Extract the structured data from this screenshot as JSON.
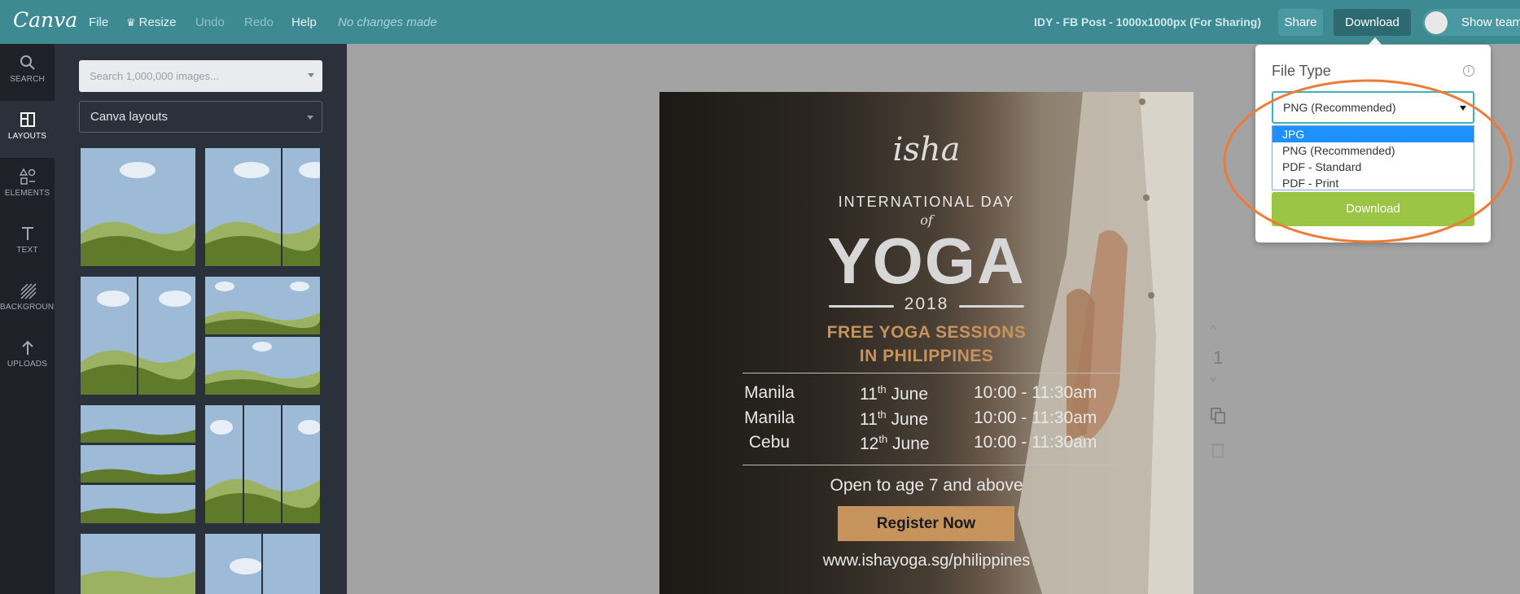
{
  "topbar": {
    "logo": "Canva",
    "menu": {
      "file": "File",
      "resize": "Resize",
      "undo": "Undo",
      "redo": "Redo",
      "help": "Help",
      "status": "No changes made"
    },
    "doc_title": "IDY - FB Post - 1000x1000px (For Sharing)",
    "share": "Share",
    "download": "Download",
    "show_team": "Show team"
  },
  "rail": {
    "items": [
      {
        "label": "SEARCH",
        "icon": "search-icon"
      },
      {
        "label": "LAYOUTS",
        "icon": "layouts-icon"
      },
      {
        "label": "ELEMENTS",
        "icon": "elements-icon"
      },
      {
        "label": "TEXT",
        "icon": "text-icon"
      },
      {
        "label": "BACKGROUND",
        "icon": "background-icon"
      },
      {
        "label": "UPLOADS",
        "icon": "uploads-icon"
      }
    ]
  },
  "panel": {
    "search_placeholder": "Search 1,000,000 images...",
    "layout_select": "Canva layouts"
  },
  "design": {
    "logo": "isha",
    "intl": "INTERNATIONAL DAY",
    "of": "of",
    "yoga": "YOGA",
    "year": "2018",
    "free1": "FREE YOGA SESSIONS",
    "free2": "IN PHILIPPINES",
    "schedule": [
      {
        "city": "Manila",
        "day": "11",
        "sup": "th",
        "month": "June",
        "time": "10:00 - 11:30am"
      },
      {
        "city": "Manila",
        "day": "11",
        "sup": "th",
        "month": "June",
        "time": "10:00 - 11:30am"
      },
      {
        "city": "Cebu",
        "day": "12",
        "sup": "th",
        "month": "June",
        "time": "10:00 - 11:30am"
      }
    ],
    "open": "Open to age 7 and above",
    "register": "Register Now",
    "url": "www.ishayoga.sg/philippines"
  },
  "page_controls": {
    "page_number": "1"
  },
  "download_popup": {
    "file_type_label": "File Type",
    "selected": "PNG (Recommended)",
    "options": [
      "JPG",
      "PNG (Recommended)",
      "PDF - Standard",
      "PDF - Print"
    ],
    "highlighted_option": "JPG",
    "button": "Download"
  },
  "colors": {
    "topbar": "#3d8a93",
    "accent_gold": "#c7935d",
    "download_green": "#9bc544",
    "highlight_orange": "#ee7a34"
  }
}
